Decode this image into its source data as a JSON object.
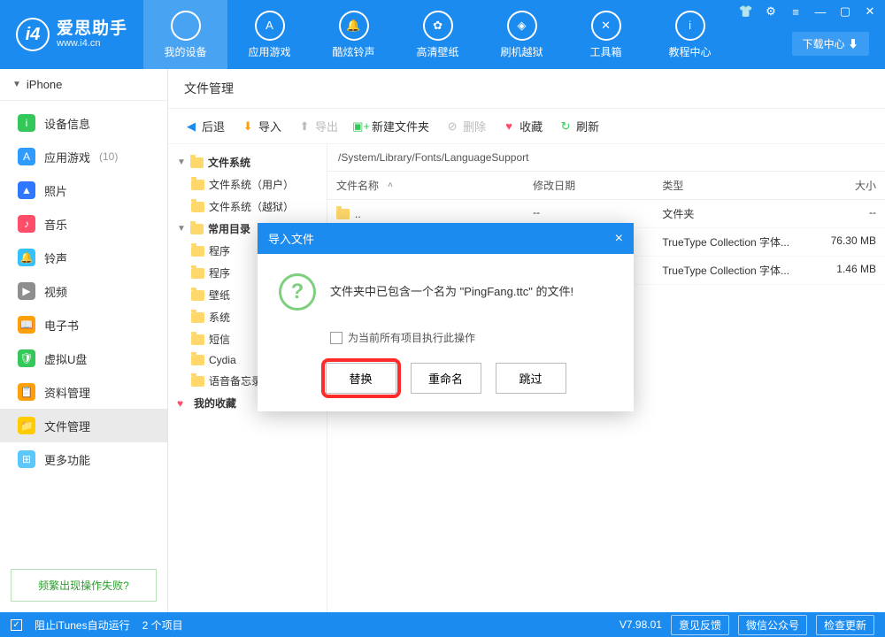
{
  "logo": {
    "title": "爱思助手",
    "sub": "www.i4.cn"
  },
  "nav": [
    {
      "label": "我的设备",
      "icon": "apple-icon"
    },
    {
      "label": "应用游戏",
      "icon": "appstore-icon"
    },
    {
      "label": "酷炫铃声",
      "icon": "bell-icon"
    },
    {
      "label": "高清壁纸",
      "icon": "flower-icon"
    },
    {
      "label": "刷机越狱",
      "icon": "cube-icon"
    },
    {
      "label": "工具箱",
      "icon": "toolbox-icon"
    },
    {
      "label": "教程中心",
      "icon": "info-icon"
    }
  ],
  "download_center": "下载中心 ⬇",
  "device_header": "iPhone",
  "sidebar": [
    {
      "label": "设备信息",
      "color": "#34c759",
      "glyph": "i"
    },
    {
      "label": "应用游戏",
      "count": "(10)",
      "color": "#2f9bff",
      "glyph": "A"
    },
    {
      "label": "照片",
      "color": "#2f77ff",
      "glyph": "▲"
    },
    {
      "label": "音乐",
      "color": "#ff4d6a",
      "glyph": "♪"
    },
    {
      "label": "铃声",
      "color": "#35c0ff",
      "glyph": "🔔"
    },
    {
      "label": "视频",
      "color": "#8e8e8e",
      "glyph": "▶"
    },
    {
      "label": "电子书",
      "color": "#ff9f0a",
      "glyph": "📖"
    },
    {
      "label": "虚拟U盘",
      "color": "#34c759",
      "glyph": "🛡"
    },
    {
      "label": "资料管理",
      "color": "#ff9f0a",
      "glyph": "📋"
    },
    {
      "label": "文件管理",
      "color": "#ffcc00",
      "glyph": "📁",
      "selected": true
    },
    {
      "label": "更多功能",
      "color": "#5ac8fa",
      "glyph": "⊞"
    }
  ],
  "faq": "频繁出现操作失败?",
  "page_title": "文件管理",
  "toolbar": {
    "back": "后退",
    "import": "导入",
    "export": "导出",
    "newfolder": "新建文件夹",
    "delete": "删除",
    "favorite": "收藏",
    "refresh": "刷新"
  },
  "tree": {
    "root": "文件系统",
    "user": "文件系统（用户）",
    "jailbreak": "文件系统（越狱）",
    "common": "常用目录",
    "items": [
      "程序",
      "程序",
      "壁纸",
      "系统",
      "短信",
      "Cydia",
      "语音备忘录"
    ],
    "fav": "我的收藏"
  },
  "path": "/System/Library/Fonts/LanguageSupport",
  "columns": {
    "name": "文件名称",
    "date": "修改日期",
    "type": "类型",
    "size": "大小"
  },
  "rows": [
    {
      "name": "..",
      "date": "--",
      "type": "文件夹",
      "size": "--"
    },
    {
      "name": "",
      "date": "",
      "type": "TrueType Collection 字体...",
      "size": "76.30 MB"
    },
    {
      "name": "",
      "date": "",
      "type": "TrueType Collection 字体...",
      "size": "1.46 MB"
    }
  ],
  "modal": {
    "title": "导入文件",
    "message": "文件夹中已包含一个名为 \"PingFang.ttc\" 的文件!",
    "checkbox": "为当前所有项目执行此操作",
    "replace": "替换",
    "rename": "重命名",
    "skip": "跳过"
  },
  "status": {
    "itunes": "阻止iTunes自动运行",
    "items": "2 个项目",
    "version": "V7.98.01",
    "feedback": "意见反馈",
    "wechat": "微信公众号",
    "update": "检查更新"
  }
}
